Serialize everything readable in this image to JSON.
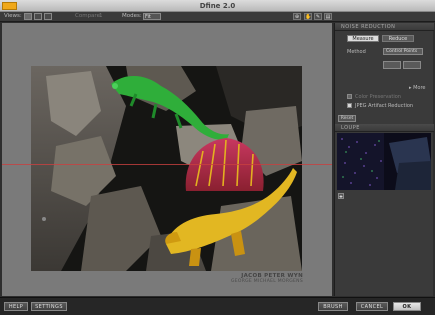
{
  "titlebar": {
    "title": "Dfine 2.0"
  },
  "toolbar": {
    "views_label": "Views:",
    "compare_label": "Compare:",
    "compare_value": "1",
    "modes_label": "Modes:",
    "modes_value": "Fit"
  },
  "canvas": {
    "caption_line1": "JACOB PETER WYN",
    "caption_line2": "GEORGE MICHAEL MORGENS"
  },
  "panel": {
    "noise_reduction_header": "NOISE REDUCTION",
    "tab_measure": "Measure",
    "tab_reduce": "Reduce",
    "method_label": "Method",
    "method_value": "Control Points",
    "more_label": "More",
    "color_preservation_label": "Color Preservation",
    "jpeg_artifact_label": "JPEG Artifact Reduction",
    "reset_label": "Reset",
    "loupe_header": "LOUPE"
  },
  "bottombar": {
    "help_label": "HELP",
    "settings_label": "SETTINGS",
    "brush_label": "BRUSH",
    "cancel_label": "CANCEL",
    "ok_label": "OK"
  }
}
